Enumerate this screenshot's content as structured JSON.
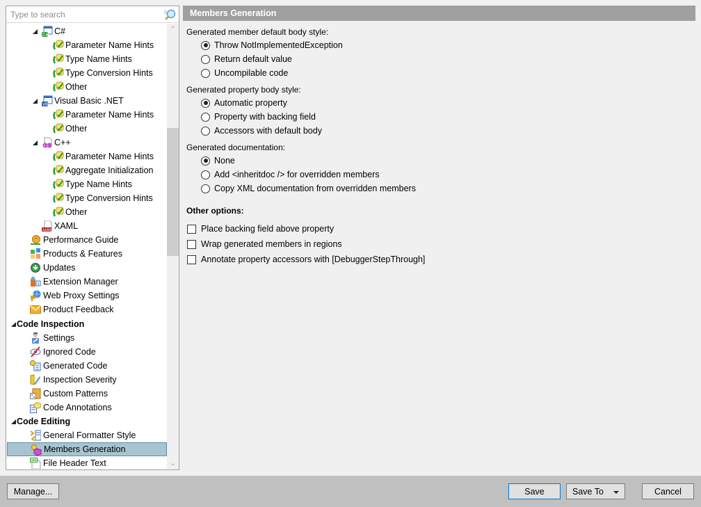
{
  "search": {
    "placeholder": "Type to search",
    "value": ""
  },
  "tree": [
    {
      "label": "C#",
      "level": 2,
      "expander": true,
      "icon": "csharp-icon",
      "bold": false
    },
    {
      "label": "Parameter Name Hints",
      "level": 3,
      "icon": "inlay-hint-icon"
    },
    {
      "label": "Type Name Hints",
      "level": 3,
      "icon": "inlay-hint-icon"
    },
    {
      "label": "Type Conversion Hints",
      "level": 3,
      "icon": "inlay-hint-icon"
    },
    {
      "label": "Other",
      "level": 3,
      "icon": "inlay-hint-icon"
    },
    {
      "label": "Visual Basic .NET",
      "level": 2,
      "expander": true,
      "icon": "vb-icon"
    },
    {
      "label": "Parameter Name Hints",
      "level": 3,
      "icon": "inlay-hint-icon"
    },
    {
      "label": "Other",
      "level": 3,
      "icon": "inlay-hint-icon"
    },
    {
      "label": "C++",
      "level": 2,
      "expander": true,
      "icon": "cpp-icon"
    },
    {
      "label": "Parameter Name Hints",
      "level": 3,
      "icon": "inlay-hint-icon"
    },
    {
      "label": "Aggregate Initialization",
      "level": 3,
      "icon": "inlay-hint-icon"
    },
    {
      "label": "Type Name Hints",
      "level": 3,
      "icon": "inlay-hint-icon"
    },
    {
      "label": "Type Conversion Hints",
      "level": 3,
      "icon": "inlay-hint-icon"
    },
    {
      "label": "Other",
      "level": 3,
      "icon": "inlay-hint-icon"
    },
    {
      "label": "XAML",
      "level": 2,
      "icon": "xaml-icon"
    },
    {
      "label": "Performance Guide",
      "level": 1,
      "icon": "snail-icon"
    },
    {
      "label": "Products & Features",
      "level": 1,
      "icon": "products-icon"
    },
    {
      "label": "Updates",
      "level": 1,
      "icon": "update-icon"
    },
    {
      "label": "Extension Manager",
      "level": 1,
      "icon": "extension-icon"
    },
    {
      "label": "Web Proxy Settings",
      "level": 1,
      "icon": "proxy-icon"
    },
    {
      "label": "Product Feedback",
      "level": 1,
      "icon": "envelope-icon"
    },
    {
      "label": "Code Inspection",
      "level": 0,
      "expander": true,
      "bold": true
    },
    {
      "label": "Settings",
      "level": 1,
      "icon": "inspector-icon"
    },
    {
      "label": "Ignored Code",
      "level": 1,
      "icon": "ignored-icon"
    },
    {
      "label": "Generated Code",
      "level": 1,
      "icon": "generated-code-icon"
    },
    {
      "label": "Inspection Severity",
      "level": 1,
      "icon": "severity-icon"
    },
    {
      "label": "Custom Patterns",
      "level": 1,
      "icon": "patterns-icon"
    },
    {
      "label": "Code Annotations",
      "level": 1,
      "icon": "annotations-icon"
    },
    {
      "label": "Code Editing",
      "level": 0,
      "expander": true,
      "bold": true
    },
    {
      "label": "General Formatter Style",
      "level": 1,
      "icon": "formatter-icon"
    },
    {
      "label": "Members Generation",
      "level": 1,
      "icon": "members-generation-icon",
      "selected": true
    },
    {
      "label": "File Header Text",
      "level": 1,
      "icon": "file-header-icon"
    }
  ],
  "page": {
    "title": "Members Generation",
    "groups": [
      {
        "label": "Generated member default body style:",
        "options": [
          {
            "label": "Throw NotImplementedException",
            "checked": true
          },
          {
            "label": "Return default value",
            "checked": false
          },
          {
            "label": "Uncompilable code",
            "checked": false
          }
        ]
      },
      {
        "label": "Generated property body style:",
        "options": [
          {
            "label": "Automatic property",
            "checked": true
          },
          {
            "label": "Property with backing field",
            "checked": false
          },
          {
            "label": "Accessors with default body",
            "checked": false
          }
        ]
      },
      {
        "label": "Generated documentation:",
        "options": [
          {
            "label": "None",
            "checked": true
          },
          {
            "label": "Add <inheritdoc /> for overridden members",
            "checked": false
          },
          {
            "label": "Copy XML documentation from overridden members",
            "checked": false
          }
        ]
      }
    ],
    "other_options_label": "Other options:",
    "checkboxes": [
      {
        "label": "Place backing field above property",
        "checked": false
      },
      {
        "label": "Wrap generated members in regions",
        "checked": false
      },
      {
        "label": "Annotate property accessors with [DebuggerStepThrough]",
        "checked": false
      }
    ]
  },
  "buttons": {
    "manage": "Manage...",
    "save": "Save",
    "save_to": "Save To",
    "cancel": "Cancel"
  },
  "colors": {
    "header_bg": "#a0a0a0",
    "selection_bg": "#a8c4d0",
    "default_button_border": "#0078d7"
  }
}
